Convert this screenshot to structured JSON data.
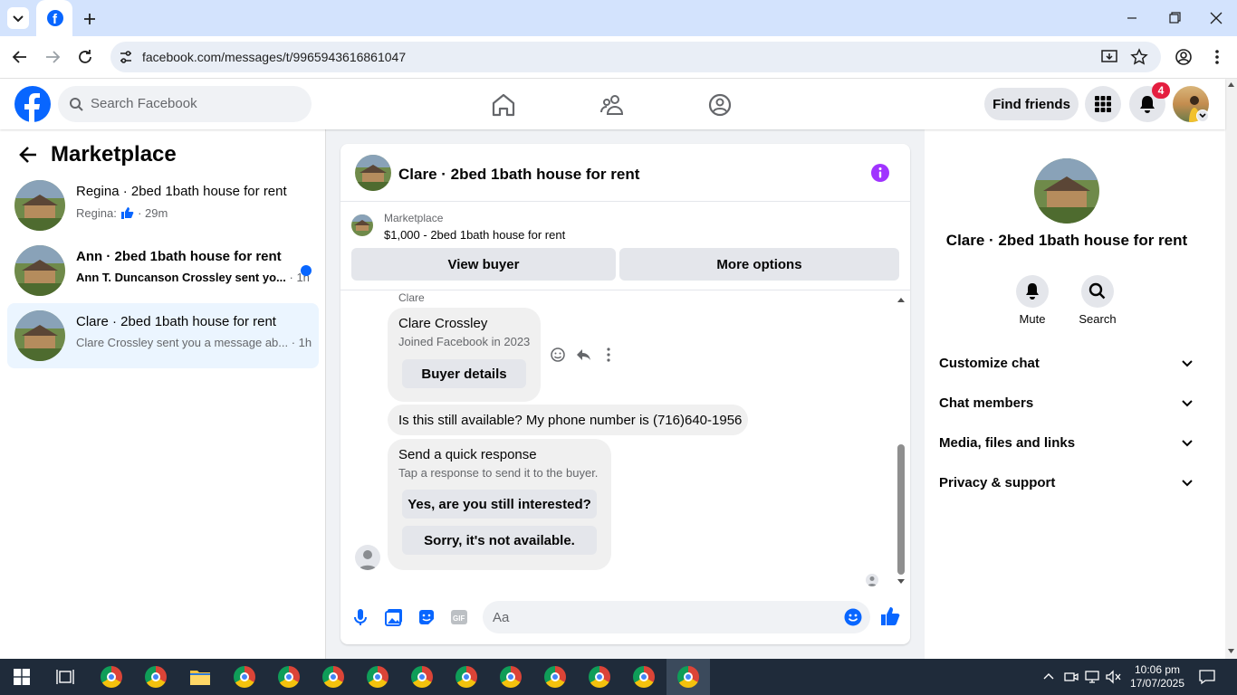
{
  "browser": {
    "url": "facebook.com/messages/t/9965943616861047"
  },
  "fb": {
    "search_placeholder": "Search Facebook",
    "find_friends": "Find friends",
    "notif_count": "4"
  },
  "left": {
    "title": "Marketplace",
    "threads": [
      {
        "title": "Regina · 2bed 1bath house for rent",
        "preview_prefix": "Regina:",
        "time": "· 29m"
      },
      {
        "title": "Ann · 2bed 1bath house for rent",
        "preview": "Ann T. Duncanson Crossley sent yo...",
        "time": "· 1h"
      },
      {
        "title": "Clare · 2bed 1bath house for rent",
        "preview": "Clare Crossley sent you a message ab...",
        "time": "· 1h"
      }
    ]
  },
  "chat": {
    "title": "Clare · 2bed 1bath house for rent",
    "listing_label": "Marketplace",
    "listing_desc": "$1,000 - 2bed 1bath house for rent",
    "view_buyer": "View buyer",
    "more_options": "More options",
    "sender": "Clare",
    "card_name": "Clare Crossley",
    "card_joined": "Joined Facebook in 2023",
    "buyer_details": "Buyer details",
    "message": "Is this still available? My phone number is (716)640-1956",
    "quick_title": "Send a quick response",
    "quick_sub": "Tap a response to send it to the buyer.",
    "quick_1": "Yes, are you still interested?",
    "quick_2": "Sorry, it's not available.",
    "composer_placeholder": "Aa"
  },
  "right": {
    "title": "Clare · 2bed 1bath house for rent",
    "mute": "Mute",
    "search": "Search",
    "sections": [
      "Customize chat",
      "Chat members",
      "Media, files and links",
      "Privacy & support"
    ]
  },
  "taskbar": {
    "time": "10:06 pm",
    "date": "17/07/2025"
  },
  "colors": {
    "fb_blue": "#0866ff",
    "messenger_purple": "#a033ff",
    "notif_red": "#e41e3f"
  }
}
